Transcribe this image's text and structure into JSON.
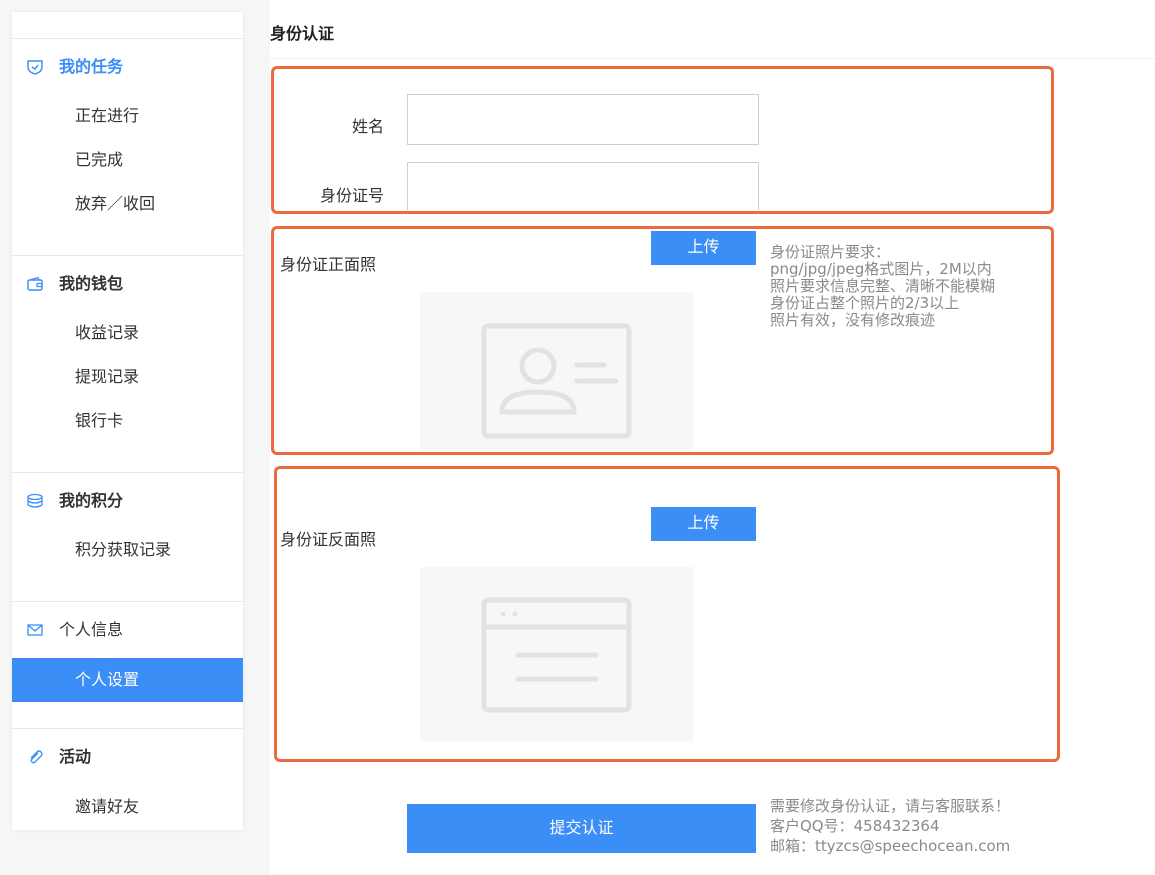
{
  "sidebar": {
    "sections": [
      {
        "title": "我的任务",
        "icon": "shield-icon",
        "items": [
          "正在进行",
          "已完成",
          "放弃／收回"
        ]
      },
      {
        "title": "我的钱包",
        "icon": "wallet-icon",
        "items": [
          "收益记录",
          "提现记录",
          "银行卡"
        ]
      },
      {
        "title": "我的积分",
        "icon": "coins-icon",
        "items": [
          "积分获取记录"
        ]
      },
      {
        "title": "个人信息",
        "icon": "mail-icon",
        "items": [
          "个人设置"
        ]
      },
      {
        "title": "活动",
        "icon": "paperclip-icon",
        "items": [
          "邀请好友"
        ]
      }
    ]
  },
  "page": {
    "title": "身份认证",
    "name_label": "姓名",
    "name_value": "",
    "id_label": "身份证号",
    "id_value": "",
    "front_label": "身份证正面照",
    "back_label": "身份证反面照",
    "upload_label": "上传",
    "requirements": [
      "身份证照片要求：",
      "png/jpg/jpeg格式图片，2M以内",
      "照片要求信息完整、清晰不能模糊",
      "身份证占整个照片的2/3以上",
      "照片有效，没有修改痕迹"
    ],
    "submit_label": "提交认证",
    "contact": [
      "需要修改身份认证，请与客服联系！",
      "客户QQ号：458432364",
      "邮箱：ttyzcs@speechocean.com"
    ]
  },
  "colors": {
    "accent": "#3a8ef6",
    "highlight": "#ec6a3e"
  }
}
